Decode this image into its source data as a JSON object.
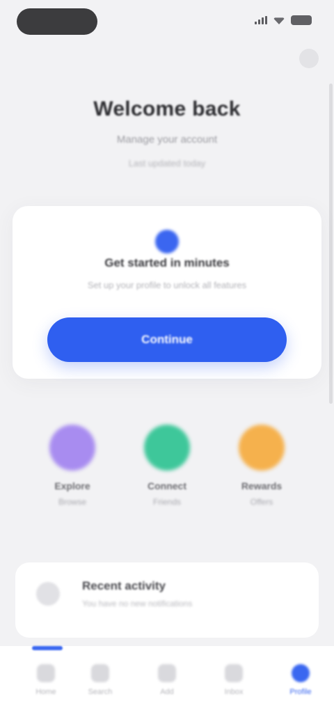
{
  "status_bar": {
    "icons": [
      "signal-icon",
      "wifi-icon",
      "battery-icon"
    ]
  },
  "header": {
    "title": "Welcome back",
    "subtitle": "Manage your account",
    "meta": "Last updated today"
  },
  "feature_card": {
    "icon": "sparkle-icon",
    "title": "Get started in minutes",
    "description": "Set up your profile to unlock all features",
    "button_label": "Continue",
    "accent": "#2f5ff0"
  },
  "quick_actions": [
    {
      "label": "Explore",
      "sub": "Browse",
      "color": "#a88cf0",
      "icon": "compass-icon"
    },
    {
      "label": "Connect",
      "sub": "Friends",
      "color": "#3ec79a",
      "icon": "users-icon"
    },
    {
      "label": "Rewards",
      "sub": "Offers",
      "color": "#f5b14d",
      "icon": "gift-icon"
    }
  ],
  "list_card": {
    "icon": "bell-icon",
    "title": "Recent activity",
    "description": "You have no new notifications"
  },
  "bottom_nav": [
    {
      "label": "Home",
      "icon": "home-icon",
      "active": false
    },
    {
      "label": "Search",
      "icon": "search-icon",
      "active": false
    },
    {
      "label": "Add",
      "icon": "plus-icon",
      "active": false
    },
    {
      "label": "Inbox",
      "icon": "inbox-icon",
      "active": false
    },
    {
      "label": "Profile",
      "icon": "profile-icon",
      "active": true
    }
  ],
  "colors": {
    "background": "#f2f2f4",
    "primary": "#2f5ff0"
  }
}
